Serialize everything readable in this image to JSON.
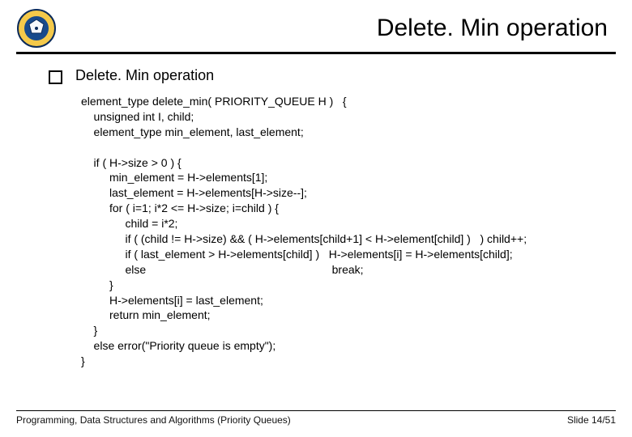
{
  "header": {
    "title": "Delete. Min operation"
  },
  "bullet": {
    "label": "Delete. Min operation"
  },
  "code": {
    "text": "element_type delete_min( PRIORITY_QUEUE H )   {\n    unsigned int I, child;\n    element_type min_element, last_element;\n\n    if ( H->size > 0 ) {\n         min_element = H->elements[1];\n         last_element = H->elements[H->size--];\n         for ( i=1; i*2 <= H->size; i=child ) {\n              child = i*2;\n              if ( (child != H->size) && ( H->elements[child+1] < H->element[child] )   ) child++;\n              if ( last_element > H->elements[child] )   H->elements[i] = H->elements[child];\n              else                                                           break;\n         }\n         H->elements[i] = last_element;\n         return min_element;\n    }\n    else error(\"Priority queue is empty\");\n}"
  },
  "footer": {
    "left": "Programming, Data Structures and Algorithms  (Priority Queues)",
    "right": "Slide 14/51"
  }
}
